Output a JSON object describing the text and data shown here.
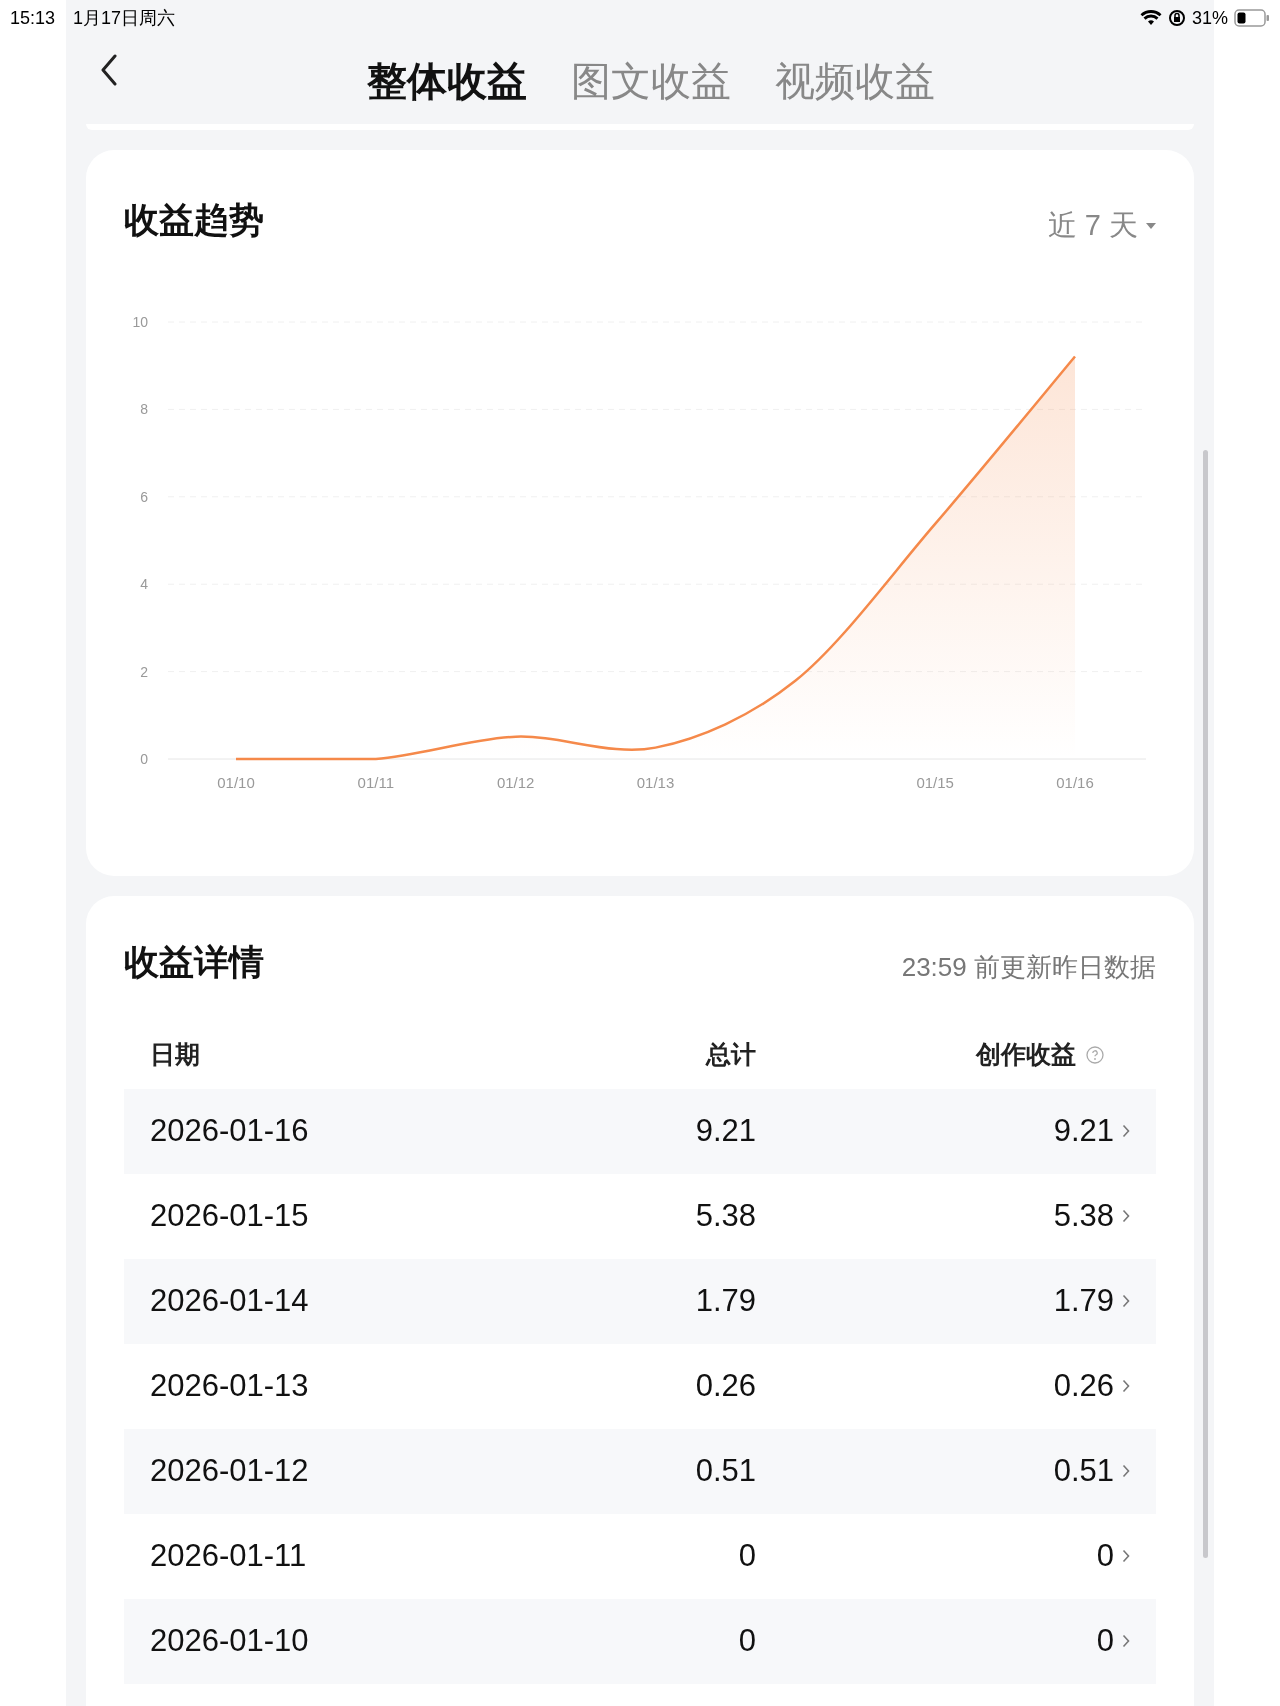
{
  "status_bar": {
    "time": "15:13",
    "date": "1月17日周六",
    "battery_percent": "31%"
  },
  "tabs": [
    {
      "label": "整体收益",
      "selected": true
    },
    {
      "label": "图文收益",
      "selected": false
    },
    {
      "label": "视频收益",
      "selected": false
    }
  ],
  "trend_card": {
    "title": "收益趋势",
    "range": "近 7 天",
    "chart_data": {
      "type": "line",
      "categories": [
        "01/10",
        "01/11",
        "01/12",
        "01/13",
        null,
        "01/15",
        "01/16"
      ],
      "ylim": [
        0,
        10
      ],
      "grid": true,
      "yticks": [
        0,
        2,
        4,
        6,
        8,
        10
      ],
      "series": [
        {
          "color": "#f5894a",
          "values": [
            0,
            0,
            0.51,
            0.26,
            1.79,
            5.38,
            9.21
          ]
        }
      ]
    }
  },
  "details_card": {
    "title": "收益详情",
    "note": "23:59 前更新昨日数据",
    "columns": [
      "日期",
      "总计",
      "创作收益"
    ],
    "rows": [
      {
        "date": "2026-01-16",
        "total": "9.21",
        "creation": "9.21"
      },
      {
        "date": "2026-01-15",
        "total": "5.38",
        "creation": "5.38"
      },
      {
        "date": "2026-01-14",
        "total": "1.79",
        "creation": "1.79"
      },
      {
        "date": "2026-01-13",
        "total": "0.26",
        "creation": "0.26"
      },
      {
        "date": "2026-01-12",
        "total": "0.51",
        "creation": "0.51"
      },
      {
        "date": "2026-01-11",
        "total": "0",
        "creation": "0"
      },
      {
        "date": "2026-01-10",
        "total": "0",
        "creation": "0"
      }
    ]
  }
}
